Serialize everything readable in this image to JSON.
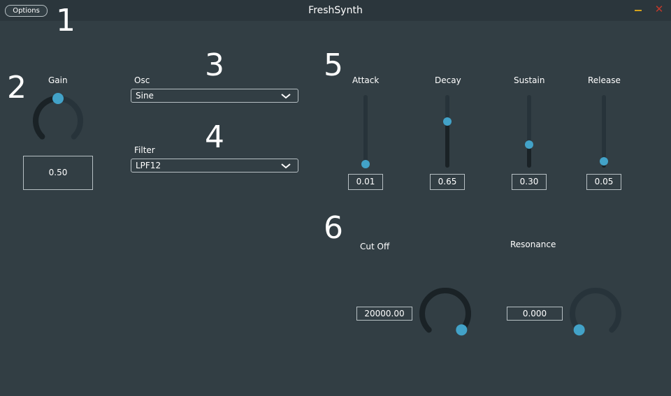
{
  "window": {
    "title": "FreshSynth",
    "options_label": "Options",
    "minimize_color": "#d4a21b",
    "close_color": "#c0392b",
    "close_glyph": "✕"
  },
  "markers": {
    "m1": "1",
    "m2": "2",
    "m3": "3",
    "m4": "4",
    "m5": "5",
    "m6": "6"
  },
  "gain": {
    "label": "Gain",
    "value": "0.50",
    "knob_fraction": 0.5
  },
  "osc": {
    "label": "Osc",
    "selected": "Sine",
    "chevron_glyph": "⌄"
  },
  "filter": {
    "label": "Filter",
    "selected": "LPF12",
    "chevron_glyph": "⌄"
  },
  "adsr": {
    "attack": {
      "label": "Attack",
      "value": "0.01",
      "fraction": 0.01
    },
    "decay": {
      "label": "Decay",
      "value": "0.65",
      "fraction": 0.65
    },
    "sustain": {
      "label": "Sustain",
      "value": "0.30",
      "fraction": 0.3
    },
    "release": {
      "label": "Release",
      "value": "0.05",
      "fraction": 0.05
    }
  },
  "cutoff": {
    "label": "Cut Off",
    "value": "20000.00",
    "knob_fraction": 1.0
  },
  "resonance": {
    "label": "Resonance",
    "value": "0.000",
    "knob_fraction": 0.0
  },
  "colors": {
    "background": "#323e44",
    "accent": "#42a2c8",
    "track": "#27333a",
    "fill": "#1a2226"
  }
}
